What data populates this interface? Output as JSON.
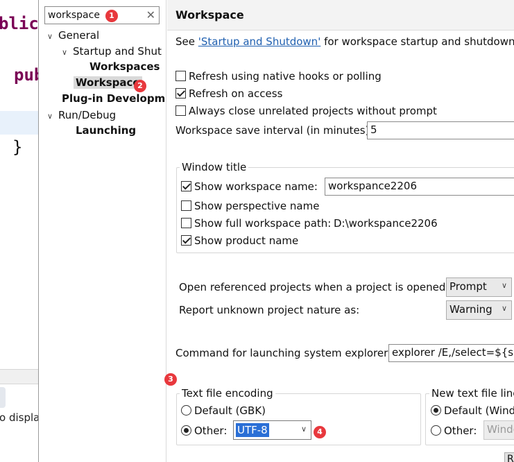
{
  "editor": {
    "code_line_1": "blic",
    "code_line_2": "pub",
    "code_line_3": "}",
    "status_text": "o displa"
  },
  "tree": {
    "filter_value": "workspace",
    "clear_icon": "close-icon",
    "items": [
      {
        "label": "General",
        "expanded": true
      },
      {
        "label": "Startup and Shut",
        "expanded": true
      },
      {
        "label": "Workspaces"
      },
      {
        "label": "Workspace",
        "selected": true
      },
      {
        "label": "Plug-in Developme"
      },
      {
        "label": "Run/Debug",
        "expanded": true
      },
      {
        "label": "Launching"
      }
    ]
  },
  "main": {
    "title": "Workspace",
    "intro_see": "See ",
    "intro_link": "'Startup and Shutdown'",
    "intro_rest": " for workspace startup and shutdown pr",
    "options": [
      {
        "label": "Refresh using native hooks or polling",
        "checked": false
      },
      {
        "label": "Refresh on access",
        "checked": true
      },
      {
        "label": "Always close unrelated projects without prompt",
        "checked": false
      }
    ],
    "save_interval_label": "Workspace save interval (in minutes):",
    "save_interval_value": "5",
    "window_title": {
      "legend": "Window title",
      "show_workspace_name_label": "Show workspace name:",
      "show_workspace_name_checked": true,
      "workspace_name_value": "workspance2206",
      "show_perspective_label": "Show perspective name",
      "show_perspective_checked": false,
      "show_full_path_label": "Show full workspace path:",
      "show_full_path_checked": false,
      "full_path_value": "D:\\workspance2206",
      "show_product_label": "Show product name",
      "show_product_checked": true
    },
    "open_referenced_label": "Open referenced projects when a project is opened:",
    "open_referenced_value": "Prompt",
    "report_unknown_label": "Report unknown project nature as:",
    "report_unknown_value": "Warning",
    "command_label": "Command for launching system explorer:",
    "command_value": "explorer /E,/select=${sel",
    "encoding": {
      "legend": "Text file encoding",
      "default_label": "Default (GBK)",
      "default_checked": false,
      "other_label": "Other:",
      "other_checked": true,
      "other_value": "UTF-8"
    },
    "line_delimiter": {
      "legend": "New text file line",
      "default_label": "Default (Wind",
      "default_checked": true,
      "other_label": "Other:",
      "other_checked": false,
      "other_value": "Windo"
    },
    "bottom_button_label": "R"
  },
  "markers": [
    "1",
    "2",
    "3",
    "4"
  ],
  "colors": {
    "marker": "#e8383d",
    "link": "#2060b0",
    "selection": "#2a6fd6",
    "keyword": "#7a0055"
  }
}
